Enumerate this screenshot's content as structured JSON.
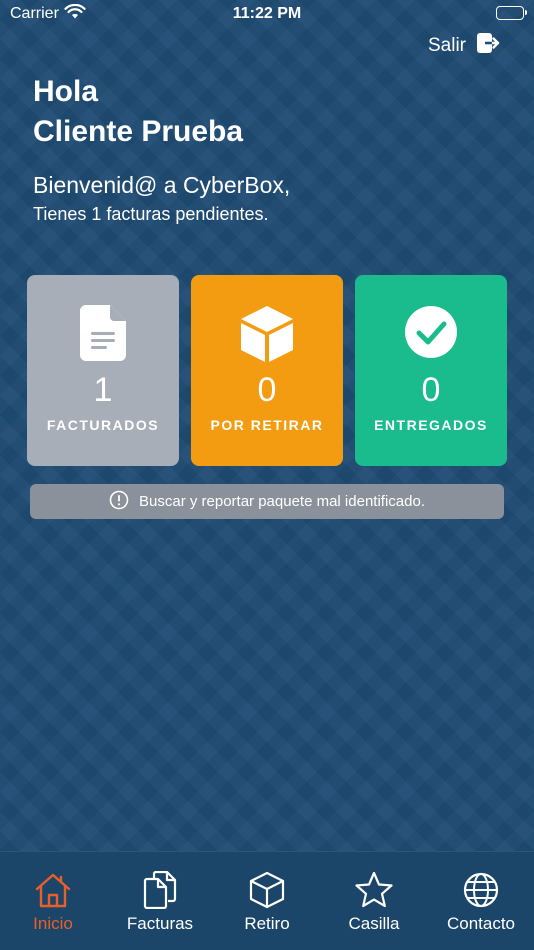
{
  "status_bar": {
    "carrier": "Carrier",
    "time": "11:22 PM"
  },
  "header": {
    "logout_label": "Salir"
  },
  "greeting": {
    "line1": "Hola",
    "line2": "Cliente Prueba"
  },
  "welcome": {
    "title": "Bienvenid@ a CyberBox,",
    "subtitle": "Tienes 1 facturas pendientes."
  },
  "cards": [
    {
      "count": "1",
      "label": "FACTURADOS",
      "icon": "document-icon",
      "color": "#a7aeb8"
    },
    {
      "count": "0",
      "label": "POR RETIRAR",
      "icon": "box-icon",
      "color": "#f39c12"
    },
    {
      "count": "0",
      "label": "ENTREGADOS",
      "icon": "check-circle-icon",
      "color": "#1abc8e"
    }
  ],
  "report_button": {
    "label": "Buscar y reportar paquete mal identificado.",
    "icon": "info-icon"
  },
  "tabs": [
    {
      "label": "Inicio",
      "icon": "home-icon",
      "active": true
    },
    {
      "label": "Facturas",
      "icon": "documents-icon"
    },
    {
      "label": "Retiro",
      "icon": "box-icon"
    },
    {
      "label": "Casilla",
      "icon": "star-icon"
    },
    {
      "label": "Contacto",
      "icon": "globe-icon"
    }
  ],
  "colors": {
    "background": "#1f4b73",
    "accent": "#e85f28",
    "tabbar": "#1c4669"
  }
}
